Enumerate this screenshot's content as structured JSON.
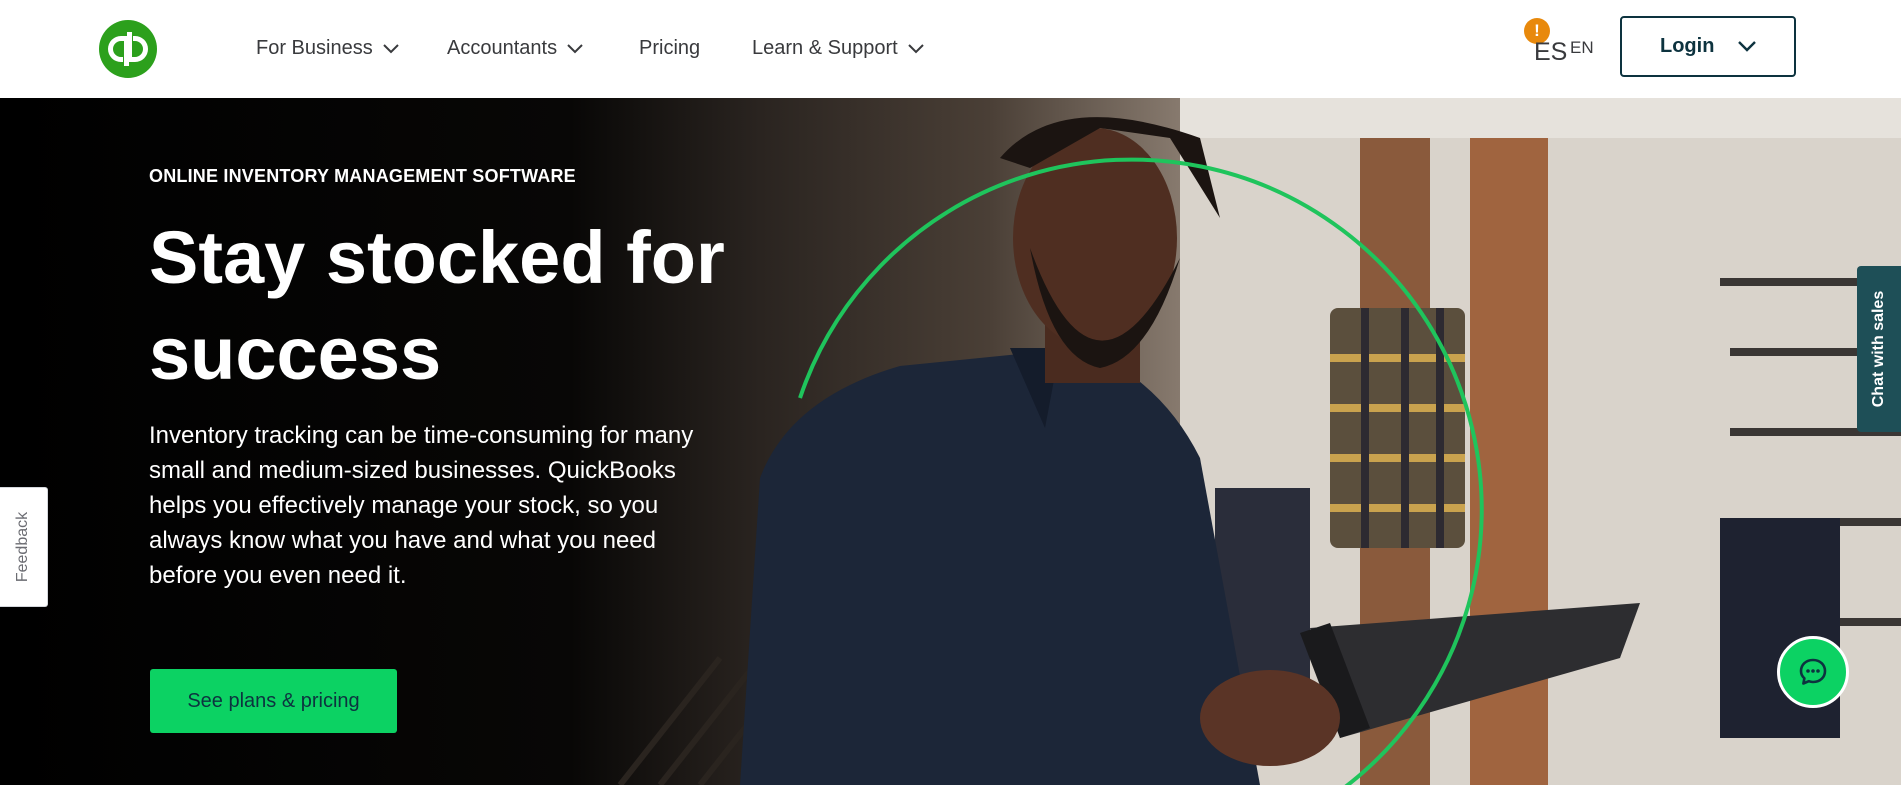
{
  "header": {
    "logo_icon": "quickbooks-logo-icon",
    "brand_color": "#2ca01c",
    "nav": [
      {
        "label": "For Business",
        "has_dropdown": true
      },
      {
        "label": "Accountants",
        "has_dropdown": true
      },
      {
        "label": "Pricing",
        "has_dropdown": false
      },
      {
        "label": "Learn & Support",
        "has_dropdown": true
      }
    ],
    "language": {
      "badge": "!",
      "current": "ES",
      "alternate": "EN"
    },
    "login_label": "Login"
  },
  "hero": {
    "eyebrow": "ONLINE INVENTORY MANAGEMENT SOFTWARE",
    "headline_line1": "Stay stocked  for",
    "headline_line2": "success",
    "description": "Inventory tracking can be time-consuming for many small and medium-sized businesses. QuickBooks helps you effectively manage your stock, so you always know what you have and what you need before you even need it.",
    "cta_label": "See plans & pricing",
    "accent_color": "#0cd263"
  },
  "widgets": {
    "feedback_label": "Feedback",
    "sales_chat_label": "Chat with sales",
    "chat_icon": "chat-bubble-icon"
  }
}
